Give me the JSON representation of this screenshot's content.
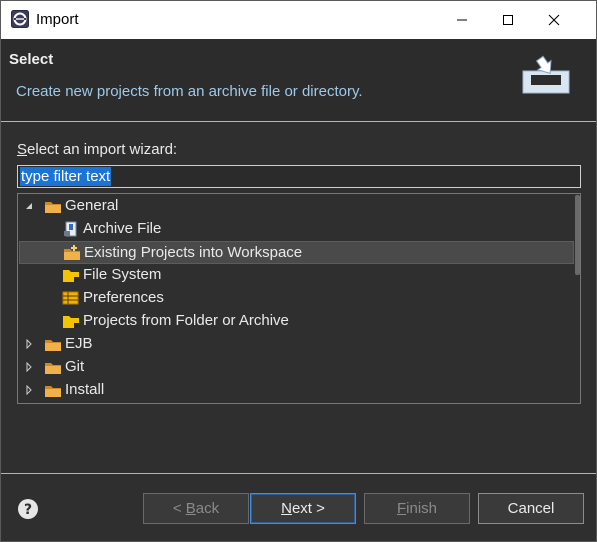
{
  "window": {
    "title": "Import",
    "minimize_glyph": "—",
    "maximize_glyph": "☐",
    "close_glyph": "✕"
  },
  "header": {
    "heading": "Select",
    "description": "Create new projects from an archive file or directory."
  },
  "wizard": {
    "label_access_key": "S",
    "label_rest": "elect an import wizard:",
    "filter_value": "type filter text"
  },
  "tree": {
    "items": [
      {
        "label": "General",
        "level": 0,
        "expanded": true,
        "icon": "folder-icon"
      },
      {
        "label": "Archive File",
        "level": 1,
        "icon": "archive-file-icon"
      },
      {
        "label": "Existing Projects into Workspace",
        "level": 1,
        "icon": "existing-projects-icon",
        "selected": true
      },
      {
        "label": "File System",
        "level": 1,
        "icon": "file-system-icon"
      },
      {
        "label": "Preferences",
        "level": 1,
        "icon": "preferences-icon"
      },
      {
        "label": "Projects from Folder or Archive",
        "level": 1,
        "icon": "projects-folder-icon"
      },
      {
        "label": "EJB",
        "level": 0,
        "expanded": false,
        "icon": "folder-icon"
      },
      {
        "label": "Git",
        "level": 0,
        "expanded": false,
        "icon": "folder-icon"
      },
      {
        "label": "Install",
        "level": 0,
        "expanded": false,
        "icon": "folder-icon"
      }
    ]
  },
  "footer": {
    "help_glyph": "?",
    "back": {
      "prefix": "< ",
      "key": "B",
      "rest": "ack",
      "enabled": false
    },
    "next": {
      "key": "N",
      "rest": "ext >",
      "enabled": true
    },
    "finish": {
      "key": "F",
      "rest": "inish",
      "enabled": false
    },
    "cancel": {
      "label": "Cancel",
      "enabled": true
    }
  },
  "colors": {
    "background": "#2f2f2f",
    "description_text": "#9ec9e8",
    "selection": "#1a73d6",
    "default_button_border": "#3d8ee0",
    "folder": "#e8a33c"
  }
}
